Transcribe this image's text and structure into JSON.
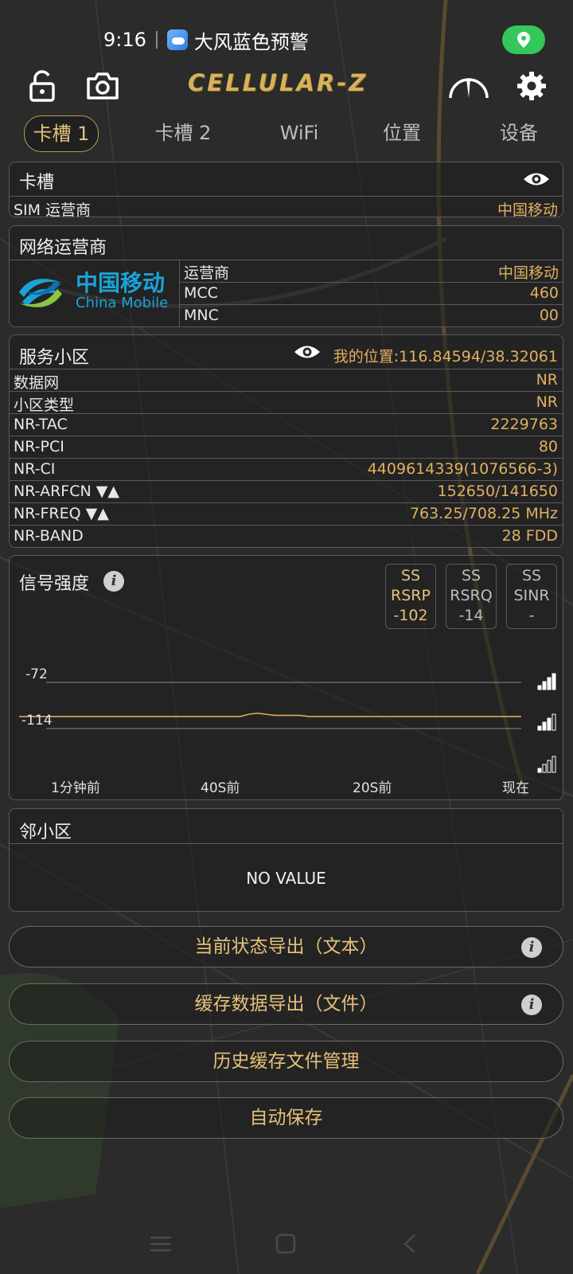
{
  "status_bar": {
    "time": "9:16",
    "notification": "大风蓝色预警"
  },
  "toolbar": {
    "app_title": "CELLULAR-Z"
  },
  "tabs": [
    {
      "label": "卡槽 1",
      "active": true
    },
    {
      "label": "卡槽 2",
      "active": false
    },
    {
      "label": "WiFi",
      "active": false
    },
    {
      "label": "位置",
      "active": false
    },
    {
      "label": "设备",
      "active": false
    }
  ],
  "slot_card": {
    "title": "卡槽",
    "sim_operator_label": "SIM 运营商",
    "sim_operator_value": "中国移动"
  },
  "network_card": {
    "title": "网络运营商",
    "logo_cn": "中国移动",
    "logo_en": "China Mobile",
    "rows": [
      {
        "key": "运营商",
        "value": "中国移动"
      },
      {
        "key": "MCC",
        "value": "460"
      },
      {
        "key": "MNC",
        "value": "00"
      }
    ]
  },
  "serving_cell": {
    "title": "服务小区",
    "location": "我的位置:116.84594/38.32061",
    "rows": [
      {
        "key": "数据网",
        "value": "NR"
      },
      {
        "key": "小区类型",
        "value": "NR"
      },
      {
        "key": "NR-TAC",
        "value": "2229763"
      },
      {
        "key": "NR-PCI",
        "value": "80"
      },
      {
        "key": "NR-CI",
        "value": "4409614339(1076566-3)"
      },
      {
        "key": "NR-ARFCN ▼▲",
        "value": "152650/141650"
      },
      {
        "key": "NR-FREQ ▼▲",
        "value": "763.25/708.25 MHz"
      },
      {
        "key": "NR-BAND",
        "value": "28 FDD"
      }
    ]
  },
  "signal": {
    "title": "信号强度",
    "metrics": [
      {
        "line1": "SS",
        "line2": "RSRP",
        "line3": "-102",
        "selected": true
      },
      {
        "line1": "SS",
        "line2": "RSRQ",
        "line3": "-14",
        "selected": false
      },
      {
        "line1": "SS",
        "line2": "SINR",
        "line3": "-",
        "selected": false
      }
    ]
  },
  "chart_data": {
    "type": "line",
    "title": "",
    "y_ticks": [
      -72,
      -114
    ],
    "x_tick_labels": [
      "1分钟前",
      "40S前",
      "20S前",
      "现在"
    ],
    "series": [
      {
        "color": "#d9a95a",
        "values": [
          -103,
          -103,
          -103,
          -103,
          -103,
          -103,
          -103,
          -103,
          -103,
          -103,
          -103,
          -103,
          -103,
          -103,
          -103,
          -103,
          -103,
          -103,
          -103,
          -103,
          -103,
          -103,
          -103,
          -103,
          -103,
          -103,
          -103,
          -101,
          -100,
          -101,
          -102,
          -102,
          -102,
          -102,
          -103,
          -103,
          -103,
          -103,
          -103,
          -103,
          -103,
          -103,
          -103,
          -103,
          -103,
          -103,
          -103,
          -103,
          -103,
          -103,
          -103,
          -103,
          -103,
          -103,
          -103,
          -103,
          -103,
          -103,
          -103,
          -103
        ]
      }
    ]
  },
  "neighbor_card": {
    "title": "邻小区",
    "empty_text": "NO VALUE"
  },
  "buttons": {
    "export_text": "当前状态导出（文本）",
    "export_file": "缓存数据导出（文件）",
    "history": "历史缓存文件管理",
    "autosave": "自动保存",
    "info_glyph": "i"
  },
  "colors": {
    "accent": "#e0b060",
    "border": "#5a5a5a",
    "location_pill": "#34c759"
  }
}
